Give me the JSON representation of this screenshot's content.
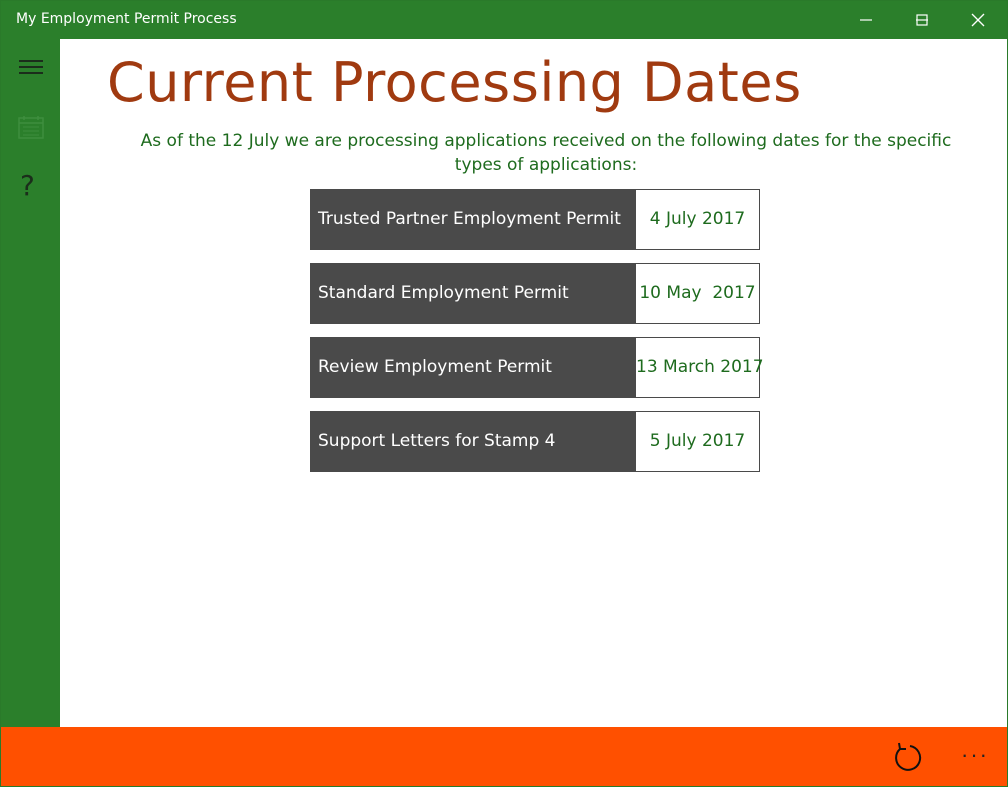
{
  "window": {
    "title": "My Employment Permit Process"
  },
  "title_bar_buttons": {
    "minimize_icon": "minimize-icon",
    "maximize_icon": "maximize-icon",
    "close_icon": "close-icon"
  },
  "sidebar": {
    "items": [
      {
        "icon": "hamburger-menu-icon"
      },
      {
        "icon": "calendar-icon"
      },
      {
        "icon": "help-icon",
        "glyph": "?"
      }
    ]
  },
  "main": {
    "title": "Current Processing Dates",
    "intro": "As of the 12 July we are processing applications received on the following dates for the specific types of applications:",
    "permits": [
      {
        "name": "Trusted Partner Employment Permit",
        "date": "4 July 2017"
      },
      {
        "name": "Standard Employment Permit",
        "date": "10 May  2017"
      },
      {
        "name": "Review Employment Permit",
        "date": "13 March 2017"
      },
      {
        "name": "Support Letters for Stamp 4",
        "date": "5 July 2017"
      }
    ]
  },
  "app_bar": {
    "refresh_icon": "refresh-icon",
    "more_glyph": "···"
  },
  "colors": {
    "chrome_green": "#2b7f2b",
    "title_brown": "#a03a10",
    "text_green": "#1e6b1e",
    "row_dark": "#4a4a4a",
    "app_bar_orange": "#ff5000"
  }
}
